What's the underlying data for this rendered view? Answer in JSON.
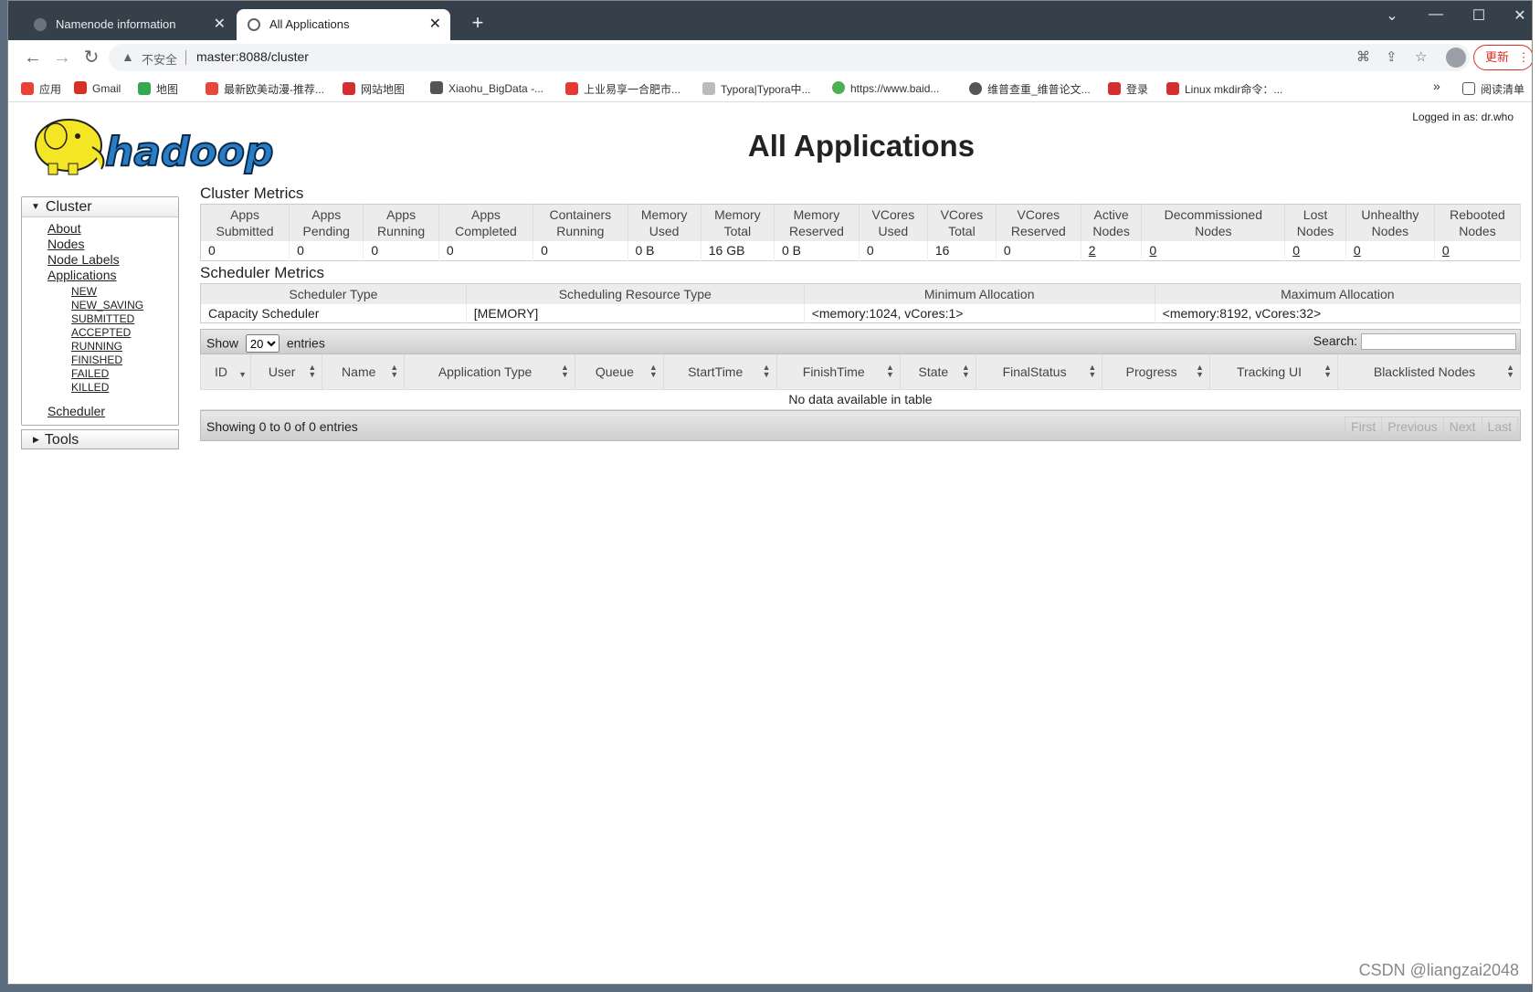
{
  "browser": {
    "tabs": [
      {
        "title": "Namenode information",
        "close": "✕"
      },
      {
        "title": "All Applications",
        "close": "✕"
      }
    ],
    "new_tab": "+",
    "window_controls": {
      "minimize": "—",
      "maximize": "☐",
      "close": "✕",
      "menu": "⌄"
    },
    "nav": {
      "back": "←",
      "forward": "→",
      "reload": "↻"
    },
    "security_label": "不安全",
    "url": "master:8088/cluster",
    "update_label": "更新",
    "bookmarks": [
      {
        "label": "应用",
        "color": "#ea4335"
      },
      {
        "label": "Gmail",
        "color": "#d93025"
      },
      {
        "label": "地图",
        "color": "#34a853"
      },
      {
        "label": "最新欧美动漫-推荐...",
        "color": "#e8453c"
      },
      {
        "label": "网站地图",
        "color": "#d32f2f"
      },
      {
        "label": "Xiaohu_BigData -...",
        "color": "#555555"
      },
      {
        "label": "上业易享一合肥市...",
        "color": "#e53935"
      },
      {
        "label": "Typora|Typora中...",
        "color": "#bbbbbb"
      },
      {
        "label": "https://www.baid...",
        "color": "#4caf50"
      },
      {
        "label": "维普查重_维普论文...",
        "color": "#555555"
      },
      {
        "label": "登录",
        "color": "#d32f2f"
      },
      {
        "label": "Linux mkdir命令：...",
        "color": "#d32f2f"
      }
    ],
    "bookmarks_more": "»",
    "reading_list": "阅读清单"
  },
  "page": {
    "title": "All Applications",
    "logged_in": "Logged in as: dr.who",
    "logo_text": "hadoop"
  },
  "sidebar": {
    "cluster_label": "Cluster",
    "links": [
      "About",
      "Nodes",
      "Node Labels",
      "Applications"
    ],
    "app_states": [
      "NEW",
      "NEW_SAVING",
      "SUBMITTED",
      "ACCEPTED",
      "RUNNING",
      "FINISHED",
      "FAILED",
      "KILLED"
    ],
    "scheduler": "Scheduler",
    "tools_label": "Tools"
  },
  "cluster_metrics": {
    "title": "Cluster Metrics",
    "headers": [
      [
        "Apps",
        "Submitted"
      ],
      [
        "Apps",
        "Pending"
      ],
      [
        "Apps",
        "Running"
      ],
      [
        "Apps",
        "Completed"
      ],
      [
        "Containers",
        "Running"
      ],
      [
        "Memory",
        "Used"
      ],
      [
        "Memory",
        "Total"
      ],
      [
        "Memory",
        "Reserved"
      ],
      [
        "VCores",
        "Used"
      ],
      [
        "VCores",
        "Total"
      ],
      [
        "VCores",
        "Reserved"
      ],
      [
        "Active",
        "Nodes"
      ],
      [
        "Decommissioned",
        "Nodes"
      ],
      [
        "Lost",
        "Nodes"
      ],
      [
        "Unhealthy",
        "Nodes"
      ],
      [
        "Rebooted",
        "Nodes"
      ]
    ],
    "values": [
      "0",
      "0",
      "0",
      "0",
      "0",
      "0 B",
      "16 GB",
      "0 B",
      "0",
      "16",
      "0",
      "2",
      "0",
      "0",
      "0",
      "0"
    ]
  },
  "scheduler_metrics": {
    "title": "Scheduler Metrics",
    "headers": [
      "Scheduler Type",
      "Scheduling Resource Type",
      "Minimum Allocation",
      "Maximum Allocation"
    ],
    "values": [
      "Capacity Scheduler",
      "[MEMORY]",
      "<memory:1024, vCores:1>",
      "<memory:8192, vCores:32>"
    ]
  },
  "apps_table": {
    "show_label": "Show",
    "entries_value": "20",
    "entries_label": "entries",
    "search_label": "Search:",
    "columns": [
      "ID",
      "User",
      "Name",
      "Application Type",
      "Queue",
      "StartTime",
      "FinishTime",
      "State",
      "FinalStatus",
      "Progress",
      "Tracking UI",
      "Blacklisted Nodes"
    ],
    "empty_message": "No data available in table",
    "info": "Showing 0 to 0 of 0 entries",
    "pager": [
      "First",
      "Previous",
      "Next",
      "Last"
    ]
  },
  "watermark": "CSDN @liangzai2048"
}
